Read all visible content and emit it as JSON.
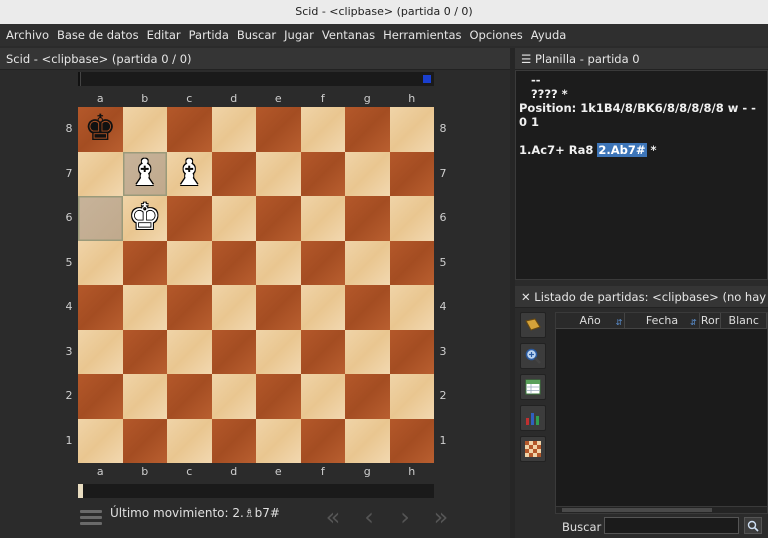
{
  "window": {
    "title": "Scid - <clipbase> (partida 0 / 0)"
  },
  "menu": [
    "Archivo",
    "Base de datos",
    "Editar",
    "Partida",
    "Buscar",
    "Jugar",
    "Ventanas",
    "Herramientas",
    "Opciones",
    "Ayuda"
  ],
  "board_pane": {
    "title": "Scid - <clipbase> (partida 0 / 0)",
    "files": [
      "a",
      "b",
      "c",
      "d",
      "e",
      "f",
      "g",
      "h"
    ],
    "ranks": [
      "8",
      "7",
      "6",
      "5",
      "4",
      "3",
      "2",
      "1"
    ],
    "pieces": [
      {
        "square": "a8",
        "glyph": "♚",
        "color": "black",
        "name": "black-king"
      },
      {
        "square": "b7",
        "glyph": "♝",
        "color": "white",
        "name": "white-bishop"
      },
      {
        "square": "c7",
        "glyph": "♝",
        "color": "white",
        "name": "white-bishop"
      },
      {
        "square": "b6",
        "glyph": "♚",
        "color": "white",
        "name": "white-king"
      }
    ],
    "highlight_squares": [
      "a6",
      "b7"
    ],
    "last_move_label": "Último movimiento: 2.♗b7#"
  },
  "notation": {
    "title": "Planilla - partida 0",
    "line1": "--",
    "line2": "????  *",
    "position": "Position: 1k1B4/8/BK6/8/8/8/8/8 w - - 0 1",
    "moves_prefix": "1.Ac7+ Ra8",
    "current_move": "2.Ab7#",
    "result": "*"
  },
  "gamelist": {
    "title": "Listado de partidas: <clipbase> (no hay pa",
    "columns": [
      "Año",
      "Fecha",
      "Ror",
      "Blanc"
    ],
    "search_label": "Buscar",
    "search_value": ""
  },
  "colors": {
    "light_square": "#f0d4a8",
    "dark_square": "#b4582a",
    "accent": "#3d75b8"
  }
}
